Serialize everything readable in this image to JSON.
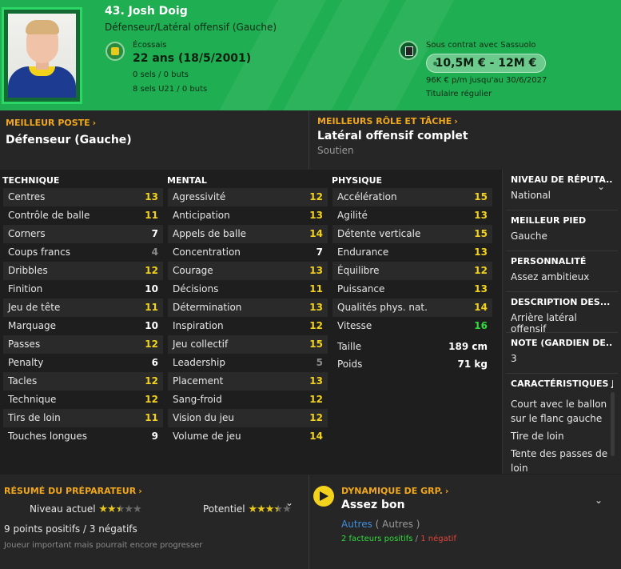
{
  "header": {
    "name": "43. Josh Doig",
    "position": "Défenseur/Latéral offensif (Gauche)",
    "nationality": "Écossais",
    "age": "22 ans (18/5/2001)",
    "caps": "0 sels / 0 buts",
    "u21_caps": "8 sels U21 / 0 buts",
    "contract": "Sous contrat avec Sassuolo",
    "value": "10,5M € - 12M €",
    "wage": "96K € p/m jusqu'au 30/6/2027",
    "status": "Titulaire régulier",
    "accent_color": "#1fae51"
  },
  "best_position": {
    "title": "MEILLEUR POSTE",
    "value": "Défenseur (Gauche)"
  },
  "best_role": {
    "title": "MEILLEURS RÔLE ET TÂCHE",
    "value": "Latéral offensif complet",
    "duty": "Soutien"
  },
  "technique": {
    "title": "TECHNIQUE",
    "rows": [
      {
        "label": "Centres",
        "value": "13"
      },
      {
        "label": "Contrôle de balle",
        "value": "11"
      },
      {
        "label": "Corners",
        "value": "7"
      },
      {
        "label": "Coups francs",
        "value": "4"
      },
      {
        "label": "Dribbles",
        "value": "12"
      },
      {
        "label": "Finition",
        "value": "10"
      },
      {
        "label": "Jeu de tête",
        "value": "11"
      },
      {
        "label": "Marquage",
        "value": "10"
      },
      {
        "label": "Passes",
        "value": "12"
      },
      {
        "label": "Penalty",
        "value": "6"
      },
      {
        "label": "Tacles",
        "value": "12"
      },
      {
        "label": "Technique",
        "value": "12"
      },
      {
        "label": "Tirs de loin",
        "value": "11"
      },
      {
        "label": "Touches longues",
        "value": "9"
      }
    ]
  },
  "mental": {
    "title": "MENTAL",
    "rows": [
      {
        "label": "Agressivité",
        "value": "12"
      },
      {
        "label": "Anticipation",
        "value": "13"
      },
      {
        "label": "Appels de balle",
        "value": "14"
      },
      {
        "label": "Concentration",
        "value": "7"
      },
      {
        "label": "Courage",
        "value": "13"
      },
      {
        "label": "Décisions",
        "value": "11"
      },
      {
        "label": "Détermination",
        "value": "13"
      },
      {
        "label": "Inspiration",
        "value": "12"
      },
      {
        "label": "Jeu collectif",
        "value": "15"
      },
      {
        "label": "Leadership",
        "value": "5"
      },
      {
        "label": "Placement",
        "value": "13"
      },
      {
        "label": "Sang-froid",
        "value": "12"
      },
      {
        "label": "Vision du jeu",
        "value": "12"
      },
      {
        "label": "Volume de jeu",
        "value": "14"
      }
    ]
  },
  "physique": {
    "title": "PHYSIQUE",
    "rows": [
      {
        "label": "Accélération",
        "value": "15"
      },
      {
        "label": "Agilité",
        "value": "13"
      },
      {
        "label": "Détente verticale",
        "value": "15"
      },
      {
        "label": "Endurance",
        "value": "13"
      },
      {
        "label": "Équilibre",
        "value": "12"
      },
      {
        "label": "Puissance",
        "value": "13"
      },
      {
        "label": "Qualités phys. nat.",
        "value": "14"
      },
      {
        "label": "Vitesse",
        "value": "16"
      }
    ],
    "height_label": "Taille",
    "height": "189 cm",
    "weight_label": "Poids",
    "weight": "71 kg"
  },
  "sidebar": {
    "reputation_title": "NIVEAU DE RÉPUTA...",
    "reputation": "National",
    "foot_title": "MEILLEUR PIED",
    "foot": "Gauche",
    "personality_title": "PERSONNALITÉ",
    "personality": "Assez ambitieux",
    "description_title": "DESCRIPTION DES...",
    "description": "Arrière latéral offensif",
    "keeper_title": "NOTE (GARDIEN DE...",
    "keeper": "3",
    "traits_title": "CARACTÉRISTIQUES J",
    "traits": [
      "Court avec le ballon sur le flanc gauche",
      "Tire de loin",
      "Tente des passes de loin"
    ]
  },
  "coach": {
    "title": "RÉSUMÉ DU PRÉPARATEUR",
    "current_label": "Niveau actuel",
    "current_stars": 2.5,
    "potential_label": "Potentiel",
    "potential_stars": 3.5,
    "points": "9 points positifs / 3 négatifs",
    "note": "Joueur important mais pourrait encore progresser"
  },
  "dynamics": {
    "title": "DYNAMIQUE DE GRP.",
    "value": "Assez bon",
    "group": "Autres",
    "group_paren": "( Autres )",
    "positive": "2 facteurs positifs",
    "separator": "/",
    "negative": "1 négatif"
  }
}
